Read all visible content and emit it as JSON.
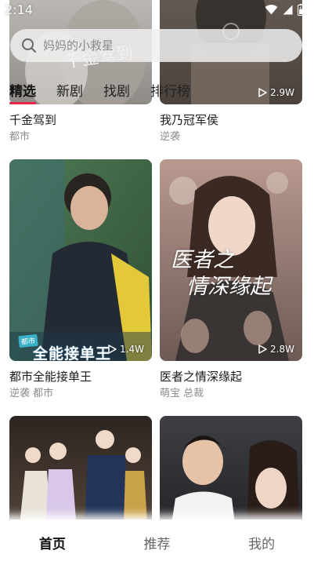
{
  "status": {
    "time": "2:14"
  },
  "search": {
    "placeholder": "妈妈的小救星"
  },
  "tabs": [
    {
      "label": "精选",
      "active": true
    },
    {
      "label": "新剧",
      "active": false
    },
    {
      "label": "找剧",
      "active": false
    },
    {
      "label": "排行榜",
      "active": false
    }
  ],
  "cards": [
    {
      "title": "千金驾到",
      "tags": "都市",
      "views": "",
      "poster_text": "千金驾到"
    },
    {
      "title": "我乃冠军侯",
      "tags": "逆袭",
      "views": "2.9W"
    },
    {
      "title": "都市全能接单王",
      "tags": "逆袭 都市",
      "views": "1.4W",
      "poster_text": "全能接单王",
      "poster_badge": "都市"
    },
    {
      "title": "医者之情深缘起",
      "tags": "萌宝 总裁",
      "views": "2.8W",
      "poster_text": [
        "医者之",
        "情深缘起"
      ]
    },
    {
      "title": "",
      "tags": "",
      "views": ""
    },
    {
      "title": "",
      "tags": "",
      "views": ""
    }
  ],
  "nav": [
    {
      "label": "首页",
      "active": true
    },
    {
      "label": "推荐",
      "active": false
    },
    {
      "label": "我的",
      "active": false
    }
  ]
}
